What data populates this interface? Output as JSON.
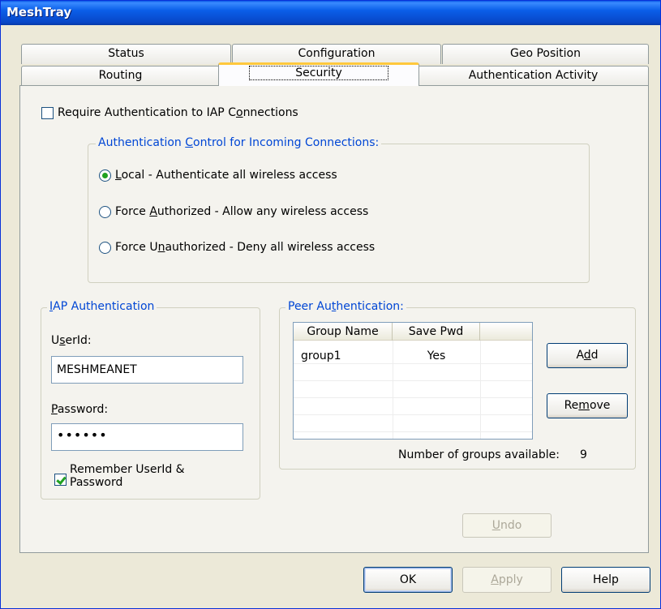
{
  "window": {
    "title": "MeshTray"
  },
  "tabs": {
    "status": "Status",
    "configuration": "Configuration",
    "geo_position": "Geo Position",
    "routing": "Routing",
    "security": "Security",
    "authentication_activity": "Authentication Activity"
  },
  "security": {
    "require_auth_pre": "Require Authentication to IAP C",
    "require_auth_u": "o",
    "require_auth_post": "nnections",
    "require_auth_checked": false,
    "auth_control": {
      "title_pre": "Authentication ",
      "title_u": "C",
      "title_post": "ontrol for Incoming Connections:",
      "options": [
        {
          "u": "L",
          "rest": "ocal - Authenticate all wireless access",
          "pre": "",
          "checked": true
        },
        {
          "pre": "Force ",
          "u": "A",
          "rest": "uthorized - Allow any wireless access",
          "checked": false
        },
        {
          "pre": "Force U",
          "u": "n",
          "rest": "authorized - Deny all wireless access",
          "checked": false
        }
      ]
    },
    "iap_auth": {
      "title_pre": "",
      "title_u": "I",
      "title_post": "AP Authentication",
      "userid_label_pre": "U",
      "userid_label_u": "s",
      "userid_label_post": "erId:",
      "userid_value": "MESHMEANET",
      "password_label_u": "P",
      "password_label_post": "assword:",
      "password_value": "••••••",
      "remember_label_line1": "Remember UserId &",
      "remember_label_line2": "Password",
      "remember_checked": true
    },
    "peer_auth": {
      "title_pre": "Peer Au",
      "title_u": "t",
      "title_post": "hentication:",
      "columns": [
        "Group Name",
        "Save Pwd"
      ],
      "rows": [
        {
          "group_name": "group1",
          "save_pwd": "Yes"
        }
      ],
      "add_pre": "A",
      "add_u": "d",
      "add_post": "d",
      "remove_pre": "Re",
      "remove_u": "m",
      "remove_post": "ove",
      "groups_available_label": "Number of groups available:",
      "groups_available_value": "9"
    },
    "undo_u": "U",
    "undo_post": "ndo"
  },
  "footer": {
    "ok": "OK",
    "apply_u": "A",
    "apply_post": "pply",
    "help": "Help"
  }
}
